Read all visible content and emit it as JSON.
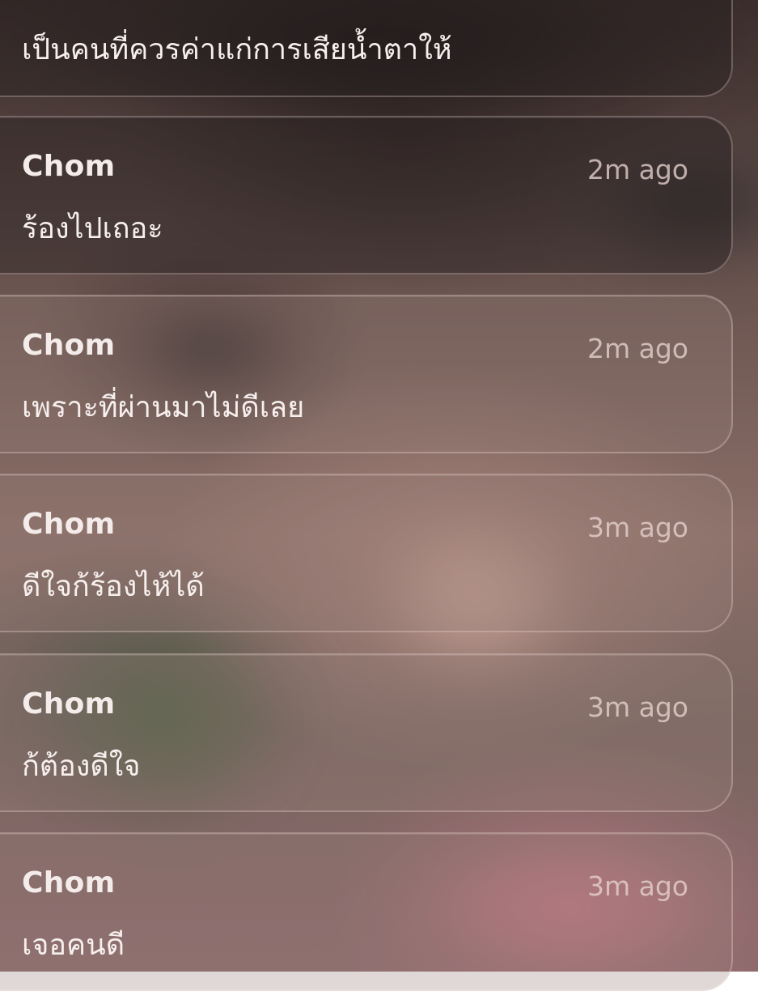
{
  "notifications": [
    {
      "sender": "",
      "time": "",
      "message": "เป็นคนที่ควรค่าแก่การเสียน้ำตาให้"
    },
    {
      "sender": "Chom",
      "time": "2m ago",
      "message": "ร้องไปเถอะ"
    },
    {
      "sender": "Chom",
      "time": "2m ago",
      "message": "เพราะที่ผ่านมาไม่ดีเลย"
    },
    {
      "sender": "Chom",
      "time": "3m ago",
      "message": "ดีใจก้ร้องไห้ได้"
    },
    {
      "sender": "Chom",
      "time": "3m ago",
      "message": "ก้ต้องดีใจ"
    },
    {
      "sender": "Chom",
      "time": "3m ago",
      "message": "เจอคนดี"
    }
  ]
}
